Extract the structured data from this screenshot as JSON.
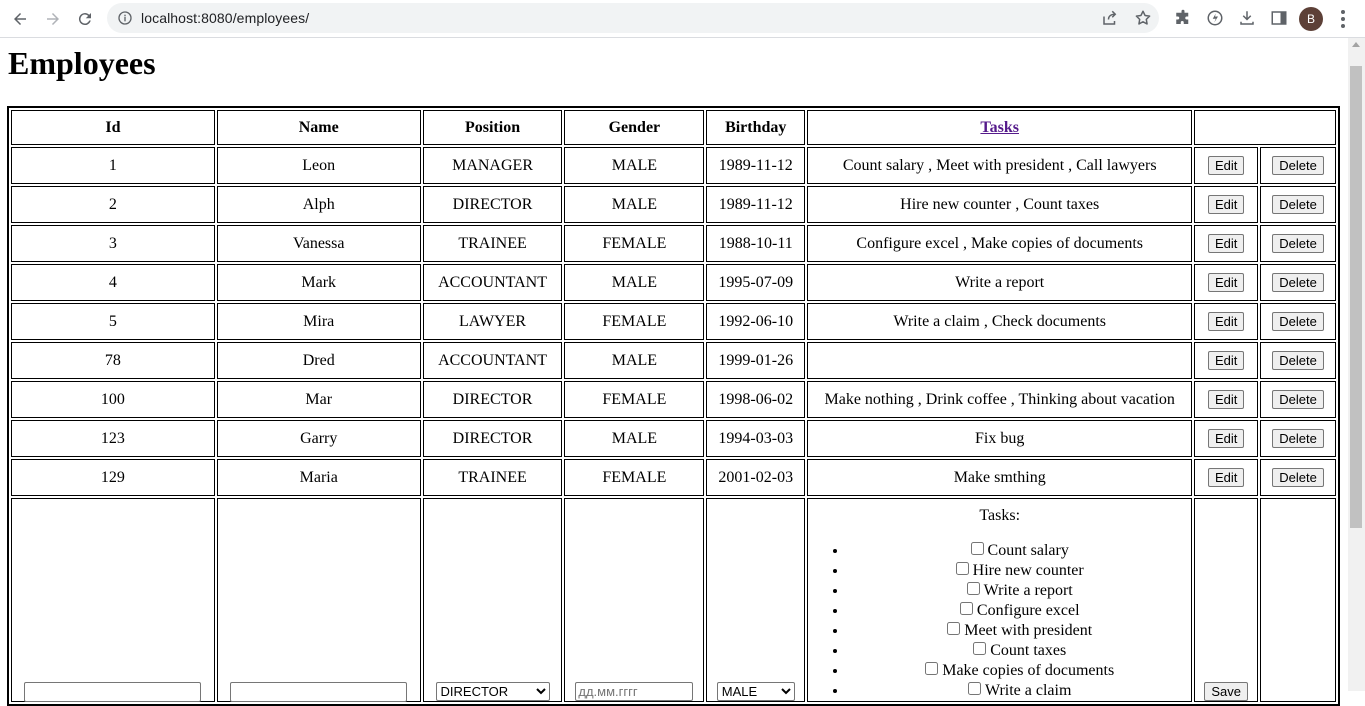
{
  "browser": {
    "url": "localhost:8080/employees/",
    "avatar_initial": "B"
  },
  "page": {
    "title": "Employees"
  },
  "table": {
    "headers": {
      "id": "Id",
      "name": "Name",
      "position": "Position",
      "gender": "Gender",
      "birthday": "Birthday",
      "tasks": "Tasks"
    },
    "rows": [
      {
        "id": "1",
        "name": "Leon",
        "position": "MANAGER",
        "gender": "MALE",
        "birthday": "1989-11-12",
        "tasks": "Count salary , Meet with president , Call lawyers"
      },
      {
        "id": "2",
        "name": "Alph",
        "position": "DIRECTOR",
        "gender": "MALE",
        "birthday": "1989-11-12",
        "tasks": "Hire new counter , Count taxes"
      },
      {
        "id": "3",
        "name": "Vanessa",
        "position": "TRAINEE",
        "gender": "FEMALE",
        "birthday": "1988-10-11",
        "tasks": "Configure excel , Make copies of documents"
      },
      {
        "id": "4",
        "name": "Mark",
        "position": "ACCOUNTANT",
        "gender": "MALE",
        "birthday": "1995-07-09",
        "tasks": "Write a report"
      },
      {
        "id": "5",
        "name": "Mira",
        "position": "LAWYER",
        "gender": "FEMALE",
        "birthday": "1992-06-10",
        "tasks": "Write a claim , Check documents"
      },
      {
        "id": "78",
        "name": "Dred",
        "position": "ACCOUNTANT",
        "gender": "MALE",
        "birthday": "1999-01-26",
        "tasks": ""
      },
      {
        "id": "100",
        "name": "Mar",
        "position": "DIRECTOR",
        "gender": "FEMALE",
        "birthday": "1998-06-02",
        "tasks": "Make nothing , Drink coffee , Thinking about vacation"
      },
      {
        "id": "123",
        "name": "Garry",
        "position": "DIRECTOR",
        "gender": "MALE",
        "birthday": "1994-03-03",
        "tasks": "Fix bug"
      },
      {
        "id": "129",
        "name": "Maria",
        "position": "TRAINEE",
        "gender": "FEMALE",
        "birthday": "2001-02-03",
        "tasks": "Make smthing"
      }
    ],
    "edit_label": "Edit",
    "delete_label": "Delete"
  },
  "form": {
    "position_selected": "DIRECTOR",
    "date_placeholder": "дд.мм.гггг",
    "gender_selected": "MALE",
    "tasks_title": "Tasks:",
    "task_options": [
      "Count salary",
      "Hire new counter",
      "Write a report",
      "Configure excel",
      "Meet with president",
      "Count taxes",
      "Make copies of documents",
      "Write a claim"
    ],
    "save_label": "Save"
  }
}
